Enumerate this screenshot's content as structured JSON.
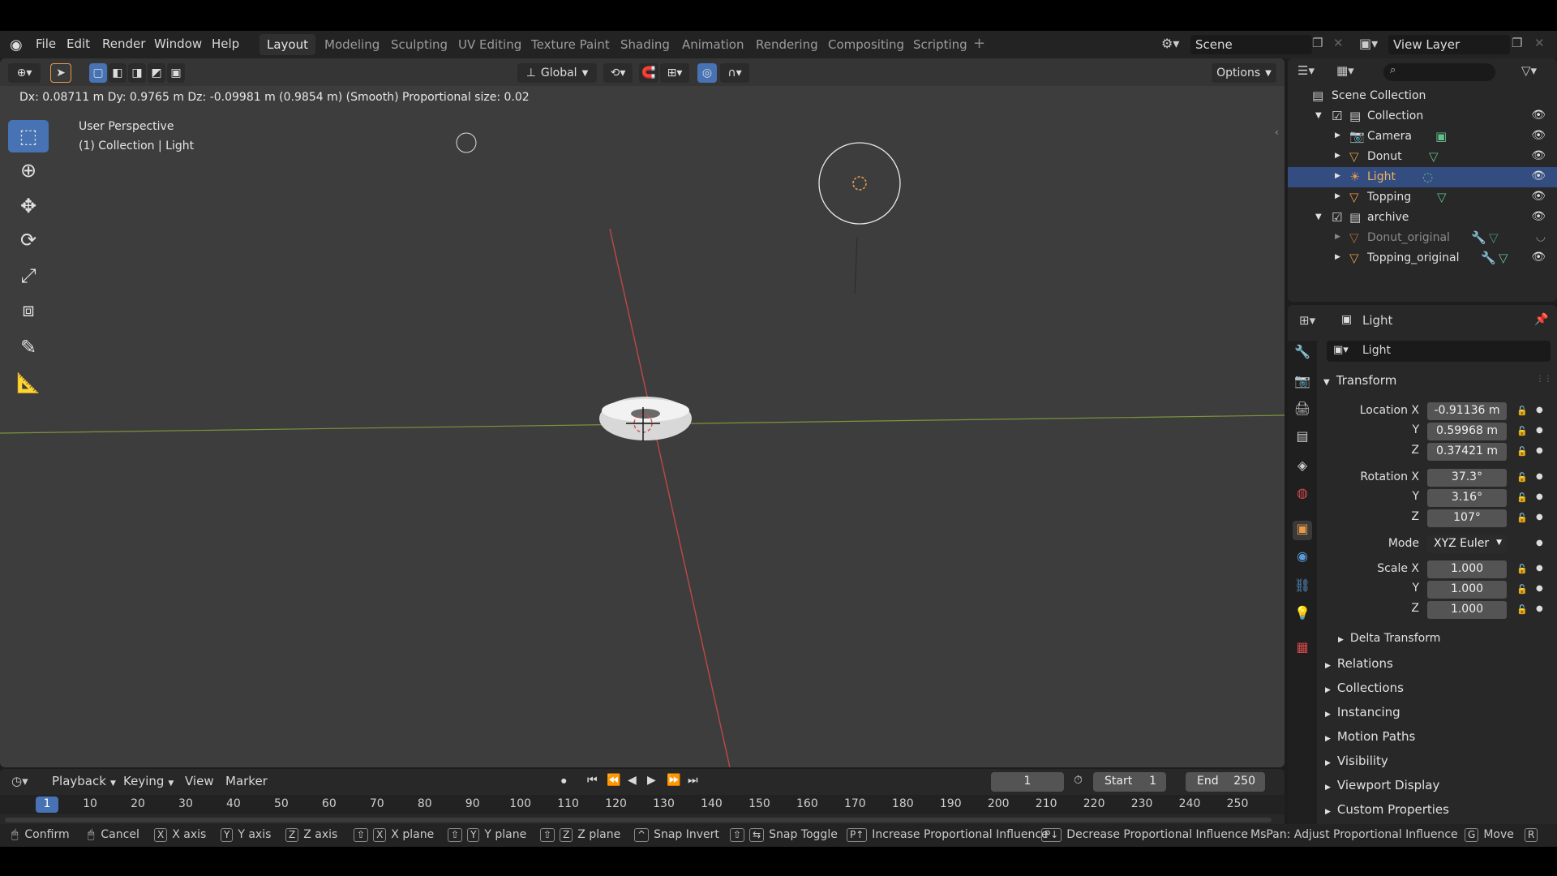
{
  "menu": [
    "File",
    "Edit",
    "Render",
    "Window",
    "Help"
  ],
  "workspaces": [
    "Layout",
    "Modeling",
    "Sculpting",
    "UV Editing",
    "Texture Paint",
    "Shading",
    "Animation",
    "Rendering",
    "Compositing",
    "Scripting"
  ],
  "active_workspace": "Layout",
  "scene": "Scene",
  "view_layer": "View Layer",
  "viewport": {
    "transform_orientation": "Global",
    "options_label": "Options",
    "status": "Dx: 0.08711 m   Dy: 0.9765 m   Dz: -0.09981 m (0.9854 m) (Smooth)    Proportional size: 0.02",
    "perspective": "User Perspective",
    "context": "(1) Collection | Light"
  },
  "outliner": {
    "scene_collection": "Scene Collection",
    "rows": [
      {
        "label": "Collection"
      },
      {
        "label": "Camera"
      },
      {
        "label": "Donut"
      },
      {
        "label": "Light"
      },
      {
        "label": "Topping"
      },
      {
        "label": "archive"
      },
      {
        "label": "Donut_original"
      },
      {
        "label": "Topping_original"
      }
    ]
  },
  "properties": {
    "header": "Light",
    "object_name": "Light",
    "transform_title": "Transform",
    "location_label": "Location X",
    "rotation_label": "Rotation X",
    "scale_label": "Scale X",
    "y": "Y",
    "z": "Z",
    "location": [
      "-0.91136 m",
      "0.59968 m",
      "0.37421 m"
    ],
    "rotation": [
      "37.3°",
      "3.16°",
      "107°"
    ],
    "mode_label": "Mode",
    "mode": "XYZ Euler",
    "scale": [
      "1.000",
      "1.000",
      "1.000"
    ],
    "panels": [
      "Delta Transform",
      "Relations",
      "Collections",
      "Instancing",
      "Motion Paths",
      "Visibility",
      "Viewport Display",
      "Custom Properties"
    ]
  },
  "timeline": {
    "playback": "Playback",
    "keying": "Keying",
    "view": "View",
    "marker": "Marker",
    "current_frame": "1",
    "start_label": "Start",
    "start": "1",
    "end_label": "End",
    "end": "250",
    "ticks": [
      "1",
      "10",
      "20",
      "30",
      "40",
      "50",
      "60",
      "70",
      "80",
      "90",
      "100",
      "110",
      "120",
      "130",
      "140",
      "150",
      "160",
      "170",
      "180",
      "190",
      "200",
      "210",
      "220",
      "230",
      "240",
      "250"
    ]
  },
  "statusbar": {
    "confirm": "Confirm",
    "cancel": "Cancel",
    "x_axis": "X axis",
    "y_axis": "Y axis",
    "z_axis": "Z axis",
    "x_plane": "X plane",
    "y_plane": "Y plane",
    "z_plane": "Z plane",
    "snap_invert": "Snap Invert",
    "snap_toggle": "Snap Toggle",
    "increase": "Increase Proportional Influence",
    "decrease": "Decrease Proportional Influence",
    "mspan": "MsPan: Adjust Proportional Influence",
    "move": "Move"
  },
  "colors": {
    "accent": "#4772b3",
    "selected_row": "#334d80",
    "object_orange": "#e59a48",
    "mesh_green": "#62c08a",
    "x_axis_red": "#d44a4a",
    "y_axis_green": "#8fb33a"
  }
}
